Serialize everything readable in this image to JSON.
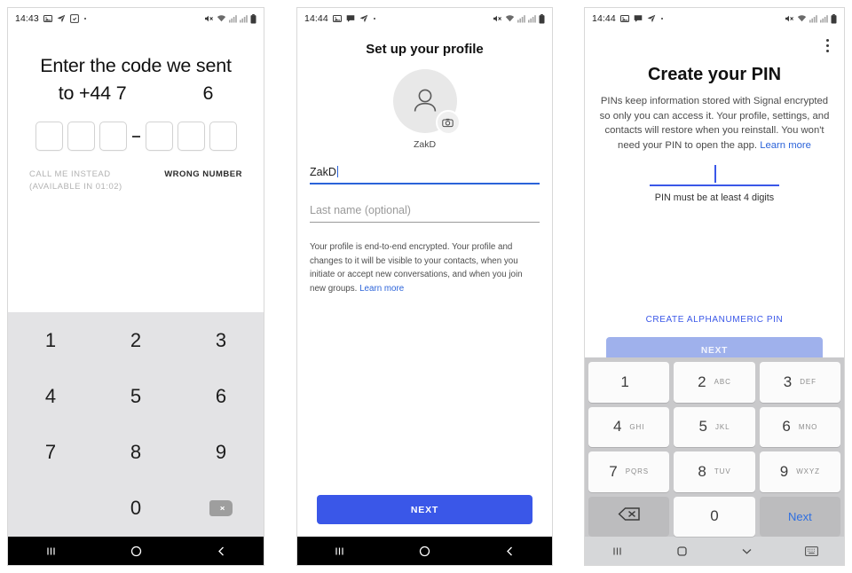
{
  "screens": [
    {
      "status": {
        "time": "14:43",
        "left_icons": [
          "photo-icon",
          "send-icon",
          "screenshot-icon",
          "dot-icon"
        ],
        "right_icons": [
          "volume-mute-icon",
          "wifi-icon",
          "signal-icon",
          "signal-icon",
          "battery-icon"
        ]
      },
      "title_line1": "Enter the code we sent",
      "title_line2_prefix": "to +44 7",
      "title_line2_suffix": "6",
      "code_boxes": [
        "",
        "",
        "",
        "",
        "",
        ""
      ],
      "separator": "-",
      "call_me_label": "CALL ME INSTEAD",
      "call_me_sub": "(AVAILABLE IN 01:02)",
      "wrong_number_label": "WRONG NUMBER",
      "keypad": [
        "1",
        "2",
        "3",
        "4",
        "5",
        "6",
        "7",
        "8",
        "9",
        "",
        "0",
        "backspace-icon"
      ],
      "nav": [
        "recents-icon",
        "home-icon",
        "back-icon"
      ]
    },
    {
      "status": {
        "time": "14:44",
        "left_icons": [
          "photo-icon",
          "message-icon",
          "send-icon",
          "dot-icon"
        ],
        "right_icons": [
          "volume-mute-icon",
          "wifi-icon",
          "signal-icon",
          "signal-icon",
          "battery-icon"
        ]
      },
      "title": "Set up your profile",
      "avatar_name": "ZakD",
      "first_name_value": "ZakD",
      "last_name_placeholder": "Last name (optional)",
      "note": "Your profile is end-to-end encrypted. Your profile and changes to it will be visible to your contacts, when you initiate or accept new conversations, and when you join new groups.",
      "note_link": "Learn more",
      "next_label": "NEXT",
      "nav": [
        "recents-icon",
        "home-icon",
        "back-icon"
      ]
    },
    {
      "status": {
        "time": "14:44",
        "left_icons": [
          "photo-icon",
          "message-icon",
          "send-icon",
          "dot-icon"
        ],
        "right_icons": [
          "volume-mute-icon",
          "wifi-icon",
          "signal-icon",
          "signal-icon",
          "battery-icon"
        ]
      },
      "title": "Create your PIN",
      "desc": "PINs keep information stored with Signal encrypted so only you can access it. Your profile, settings, and contacts will restore when you reinstall. You won't need your PIN to open the app.",
      "desc_link": "Learn more",
      "pin_value": "",
      "pin_hint": "PIN must be at least 4 digits",
      "alphanumeric_label": "CREATE ALPHANUMERIC PIN",
      "next_label": "NEXT",
      "keypad": [
        {
          "digit": "1",
          "letters": ""
        },
        {
          "digit": "2",
          "letters": "ABC"
        },
        {
          "digit": "3",
          "letters": "DEF"
        },
        {
          "digit": "4",
          "letters": "GHI"
        },
        {
          "digit": "5",
          "letters": "JKL"
        },
        {
          "digit": "6",
          "letters": "MNO"
        },
        {
          "digit": "7",
          "letters": "PQRS"
        },
        {
          "digit": "8",
          "letters": "TUV"
        },
        {
          "digit": "9",
          "letters": "WXYZ"
        }
      ],
      "keypad_backspace": "backspace-icon",
      "keypad_zero": "0",
      "keypad_next": "Next",
      "nav": [
        "recents-icon",
        "home-icon",
        "hide-keyboard-icon",
        "keyboard-icon"
      ]
    }
  ],
  "colors": {
    "accent_blue": "#3a57e8",
    "link_blue": "#2b63d9",
    "disabled_blue": "#9fb1ec",
    "keypad_grey": "#e3e3e5",
    "keypad3_bg": "#c9c9cb"
  }
}
